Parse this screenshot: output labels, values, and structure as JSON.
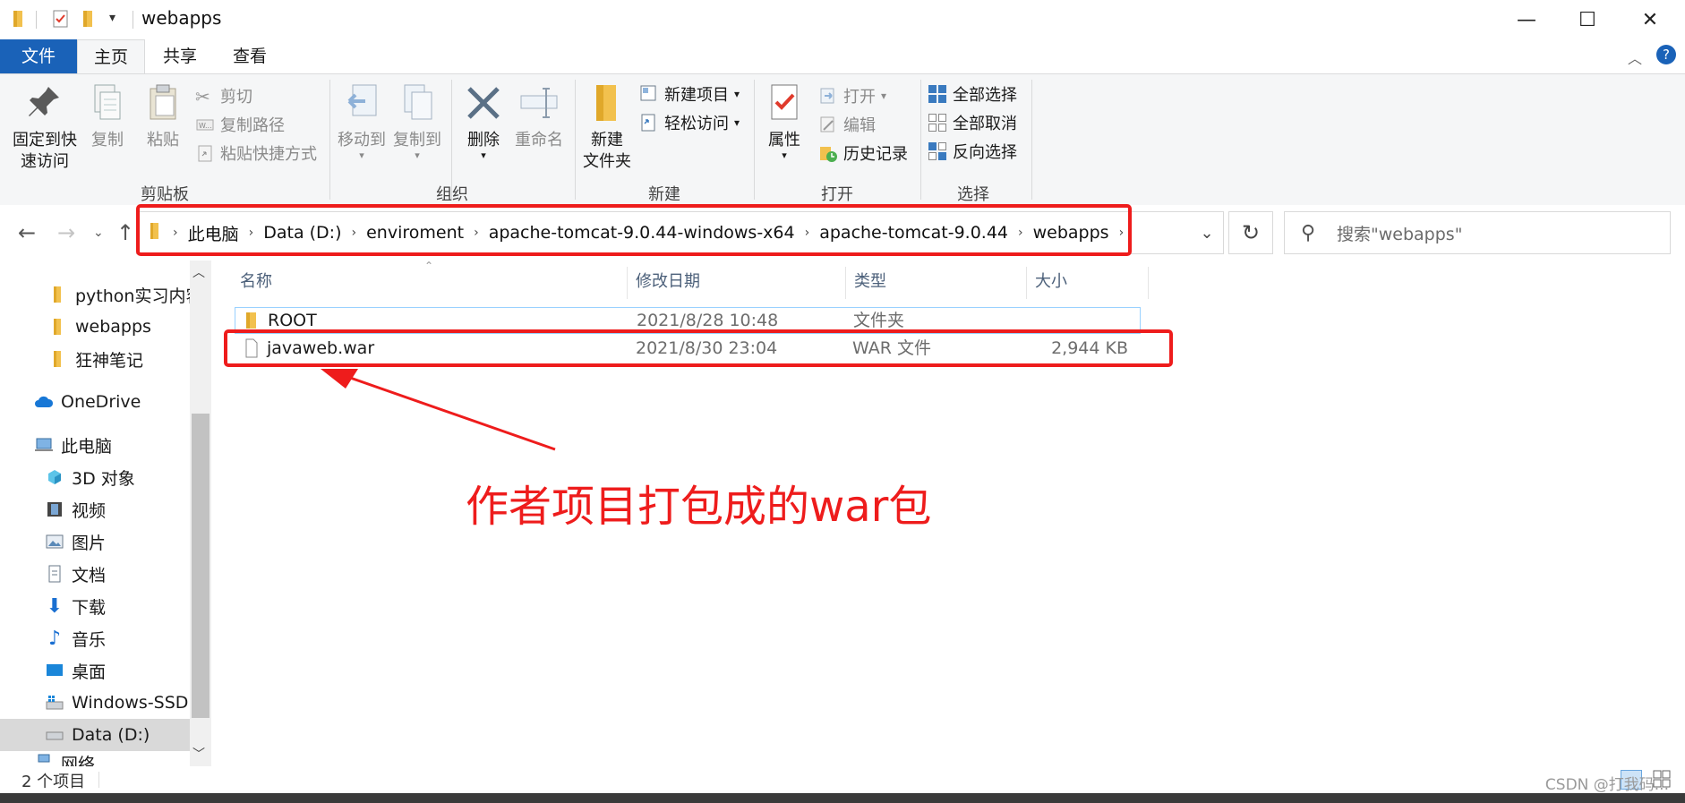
{
  "window": {
    "title": "webapps",
    "minimize_glyph": "—",
    "maximize_glyph": "☐",
    "close_glyph": "✕"
  },
  "tabs": {
    "file": "文件",
    "home": "主页",
    "share": "共享",
    "view": "查看"
  },
  "ribbon": {
    "clipboard": {
      "label": "剪贴板",
      "pin_line1": "固定到快",
      "pin_line2": "速访问",
      "copy": "复制",
      "paste": "粘贴",
      "cut": "剪切",
      "copy_path": "复制路径",
      "paste_shortcut": "粘贴快捷方式"
    },
    "organize": {
      "label": "组织",
      "move_to": "移动到",
      "copy_to": "复制到",
      "delete": "删除",
      "rename": "重命名"
    },
    "new": {
      "label": "新建",
      "new_folder_line1": "新建",
      "new_folder_line2": "文件夹",
      "new_item": "新建项目",
      "easy_access": "轻松访问"
    },
    "open": {
      "label": "打开",
      "properties": "属性",
      "open": "打开",
      "edit": "编辑",
      "history": "历史记录"
    },
    "select": {
      "label": "选择",
      "select_all": "全部选择",
      "select_none": "全部取消",
      "invert": "反向选择"
    }
  },
  "address": {
    "crumbs": [
      "此电脑",
      "Data (D:)",
      "enviroment",
      "apache-tomcat-9.0.44-windows-x64",
      "apache-tomcat-9.0.44",
      "webapps"
    ],
    "search_placeholder": "搜索\"webapps\""
  },
  "nav_pane": {
    "items": [
      "python实习内容",
      "webapps",
      "狂神笔记",
      "OneDrive",
      "此电脑",
      "3D 对象",
      "视频",
      "图片",
      "文档",
      "下载",
      "音乐",
      "桌面",
      "Windows-SSD (",
      "Data (D:)",
      "网络"
    ]
  },
  "columns": {
    "name": "名称",
    "date": "修改日期",
    "type": "类型",
    "size": "大小"
  },
  "files": [
    {
      "name": "ROOT",
      "date": "2021/8/28 10:48",
      "type": "文件夹",
      "size": ""
    },
    {
      "name": "javaweb.war",
      "date": "2021/8/30 23:04",
      "type": "WAR 文件",
      "size": "2,944 KB"
    }
  ],
  "status": {
    "count": "2 个项目"
  },
  "annotation": {
    "text": "作者项目打包成的war包",
    "color": "#ee1c1c"
  },
  "watermark": "CSDN @打我码..."
}
